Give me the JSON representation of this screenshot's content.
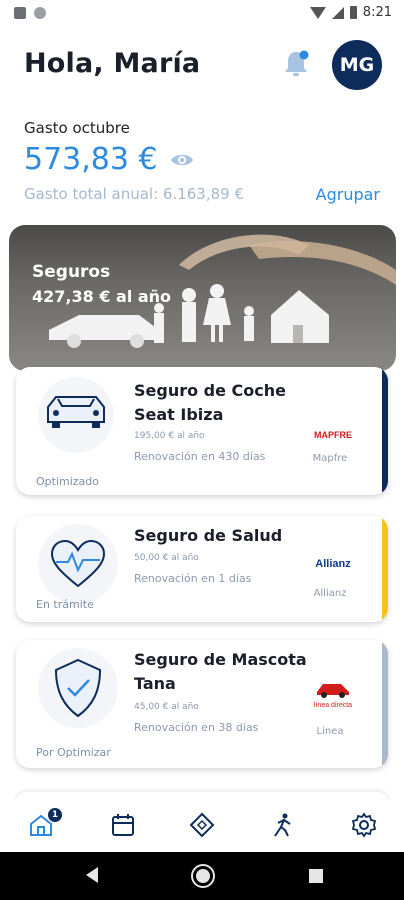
{
  "status_bar": {
    "time": "8:21"
  },
  "header": {
    "greeting": "Hola, María",
    "avatar_initials": "MG"
  },
  "spending": {
    "label": "Gasto octubre",
    "amount": "573,83 €",
    "annual": "Gasto total anual: 6.163,89 €",
    "group_link": "Agrupar"
  },
  "banner": {
    "title": "Seguros",
    "subtitle": "427,38 € al año"
  },
  "cards": [
    {
      "title": "Seguro de Coche Seat Ibiza",
      "price": "195,00 € al año",
      "renewal": "Renovación en 430 días",
      "status": "Optimizado",
      "insurer": "Mapfre",
      "logo_text": "MAPFRE",
      "stripe_color": "#0d2b5b",
      "icon": "car-icon"
    },
    {
      "title": "Seguro de Salud",
      "price": "50,00 € al año",
      "renewal": "Renovación en 1 días",
      "status": "En trámite",
      "insurer": "Allianz",
      "logo_text": "Allianz",
      "stripe_color": "#f5c21b",
      "icon": "heart-icon"
    },
    {
      "title": "Seguro de Mascota Tana",
      "price": "45,00 € al año",
      "renewal": "Renovación en 38 días",
      "status": "Por Optimizar",
      "insurer": "Linea",
      "logo_text": "línea directa",
      "stripe_color": "#a7b8cf",
      "icon": "shield-icon"
    }
  ],
  "tabbar": {
    "badge_count": "1",
    "tabs": [
      "home-icon",
      "calendar-icon",
      "diamond-icon",
      "person-running-icon",
      "gear-icon"
    ]
  },
  "colors": {
    "accent": "#2d8ae0",
    "brand_navy": "#0d2b5b",
    "muted": "#a4b9cf"
  }
}
